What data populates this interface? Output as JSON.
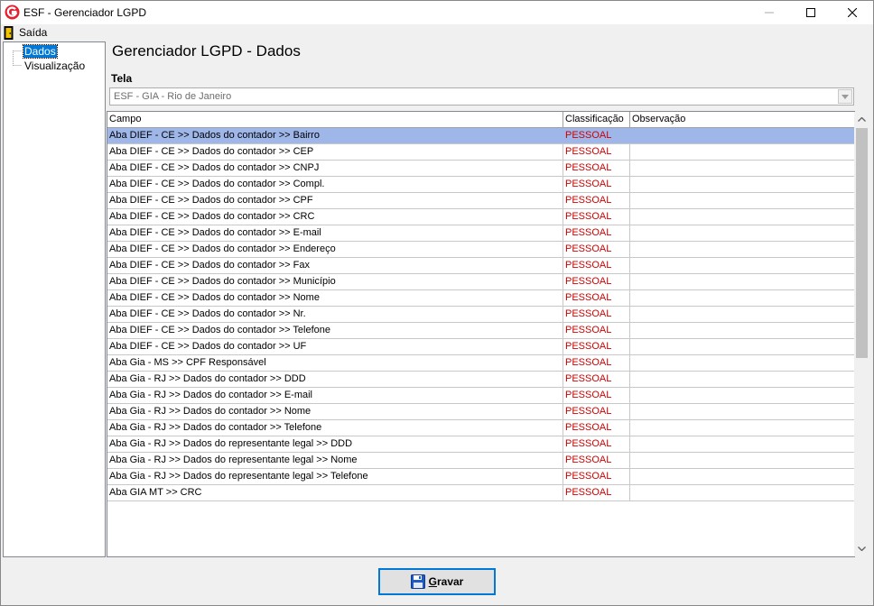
{
  "window": {
    "title": "ESF - Gerenciador LGPD"
  },
  "menu": {
    "exit_label": "Saída",
    "exit_icon": "door-exit-icon"
  },
  "tree": {
    "items": [
      {
        "label": "Dados",
        "selected": true
      },
      {
        "label": "Visualização",
        "selected": false
      }
    ]
  },
  "main": {
    "title": "Gerenciador LGPD - Dados",
    "tela_label": "Tela",
    "tela_value": "ESF - GIA - Rio de Janeiro"
  },
  "grid": {
    "columns": [
      "Campo",
      "Classificação",
      "Observação"
    ],
    "rows": [
      {
        "campo": "Aba DIEF - CE >> Dados do contador >> Bairro",
        "classificacao": "PESSOAL",
        "observacao": "",
        "selected": true
      },
      {
        "campo": "Aba DIEF - CE >> Dados do contador >> CEP",
        "classificacao": "PESSOAL",
        "observacao": ""
      },
      {
        "campo": "Aba DIEF - CE >> Dados do contador >> CNPJ",
        "classificacao": "PESSOAL",
        "observacao": ""
      },
      {
        "campo": "Aba DIEF - CE >> Dados do contador >> Compl.",
        "classificacao": "PESSOAL",
        "observacao": ""
      },
      {
        "campo": "Aba DIEF - CE >> Dados do contador >> CPF",
        "classificacao": "PESSOAL",
        "observacao": ""
      },
      {
        "campo": "Aba DIEF - CE >> Dados do contador >> CRC",
        "classificacao": "PESSOAL",
        "observacao": ""
      },
      {
        "campo": "Aba DIEF - CE >> Dados do contador >> E-mail",
        "classificacao": "PESSOAL",
        "observacao": ""
      },
      {
        "campo": "Aba DIEF - CE >> Dados do contador >> Endereço",
        "classificacao": "PESSOAL",
        "observacao": ""
      },
      {
        "campo": "Aba DIEF - CE >> Dados do contador >> Fax",
        "classificacao": "PESSOAL",
        "observacao": ""
      },
      {
        "campo": "Aba DIEF - CE >> Dados do contador >> Município",
        "classificacao": "PESSOAL",
        "observacao": ""
      },
      {
        "campo": "Aba DIEF - CE >> Dados do contador >> Nome",
        "classificacao": "PESSOAL",
        "observacao": ""
      },
      {
        "campo": "Aba DIEF - CE >> Dados do contador >> Nr.",
        "classificacao": "PESSOAL",
        "observacao": ""
      },
      {
        "campo": "Aba DIEF - CE >> Dados do contador >> Telefone",
        "classificacao": "PESSOAL",
        "observacao": ""
      },
      {
        "campo": "Aba DIEF - CE >> Dados do contador >> UF",
        "classificacao": "PESSOAL",
        "observacao": ""
      },
      {
        "campo": "Aba Gia - MS >> CPF Responsável",
        "classificacao": "PESSOAL",
        "observacao": ""
      },
      {
        "campo": "Aba Gia - RJ >> Dados do contador >> DDD",
        "classificacao": "PESSOAL",
        "observacao": ""
      },
      {
        "campo": "Aba Gia - RJ >> Dados do contador >> E-mail",
        "classificacao": "PESSOAL",
        "observacao": ""
      },
      {
        "campo": "Aba Gia - RJ >> Dados do contador >> Nome",
        "classificacao": "PESSOAL",
        "observacao": ""
      },
      {
        "campo": "Aba Gia - RJ >> Dados do contador >> Telefone",
        "classificacao": "PESSOAL",
        "observacao": ""
      },
      {
        "campo": "Aba Gia - RJ >> Dados do representante legal >> DDD",
        "classificacao": "PESSOAL",
        "observacao": ""
      },
      {
        "campo": "Aba Gia - RJ >> Dados do representante legal >> Nome",
        "classificacao": "PESSOAL",
        "observacao": ""
      },
      {
        "campo": "Aba Gia - RJ >> Dados do representante legal >> Telefone",
        "classificacao": "PESSOAL",
        "observacao": ""
      },
      {
        "campo": "Aba GIA MT >> CRC",
        "classificacao": "PESSOAL",
        "observacao": ""
      }
    ]
  },
  "footer": {
    "save_label": "Gravar",
    "save_icon": "floppy-disk-icon"
  },
  "colors": {
    "selection": "#9fb6e8",
    "classification_text": "#d00000",
    "tree_selection": "#0078d7",
    "logo_red": "#e4202e"
  }
}
